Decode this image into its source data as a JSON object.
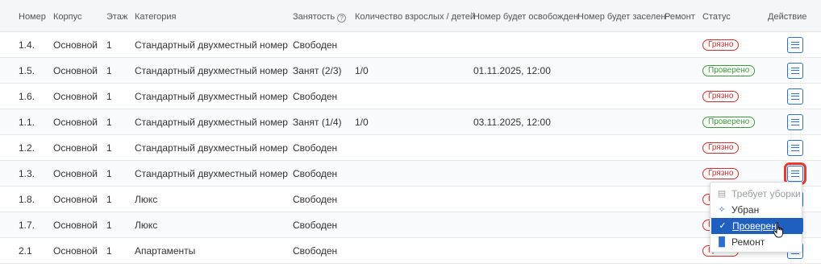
{
  "headers": {
    "num": "Номер",
    "building": "Корпус",
    "floor": "Этаж",
    "category": "Категория",
    "occupancy": "Занятость",
    "guests": "Количество взрослых / детей",
    "freed": "Номер будет освобожден",
    "settled": "Номер будет заселен",
    "repair": "Ремонт",
    "status": "Статус",
    "action": "Действие"
  },
  "rows": [
    {
      "num": "1.4.",
      "building": "Основной",
      "floor": "1",
      "category": "Стандартный двухместный номер",
      "occupancy": "Свободен",
      "guests": "",
      "freed": "",
      "status": "Грязно",
      "status_type": "dirty"
    },
    {
      "num": "1.5.",
      "building": "Основной",
      "floor": "1",
      "category": "Стандартный двухместный номер",
      "occupancy": "Занят (2/3)",
      "guests": "1/0",
      "freed": "01.11.2025, 12:00",
      "status": "Проверено",
      "status_type": "checked"
    },
    {
      "num": "1.6.",
      "building": "Основной",
      "floor": "1",
      "category": "Стандартный двухместный номер",
      "occupancy": "Свободен",
      "guests": "",
      "freed": "",
      "status": "Грязно",
      "status_type": "dirty"
    },
    {
      "num": "1.1.",
      "building": "Основной",
      "floor": "1",
      "category": "Стандартный двухместный номер",
      "occupancy": "Занят (1/4)",
      "guests": "1/0",
      "freed": "03.11.2025, 12:00",
      "status": "Проверено",
      "status_type": "checked"
    },
    {
      "num": "1.2.",
      "building": "Основной",
      "floor": "1",
      "category": "Стандартный двухместный номер",
      "occupancy": "Свободен",
      "guests": "",
      "freed": "",
      "status": "Грязно",
      "status_type": "dirty"
    },
    {
      "num": "1.3.",
      "building": "Основной",
      "floor": "1",
      "category": "Стандартный двухместный номер",
      "occupancy": "Свободен",
      "guests": "",
      "freed": "",
      "status": "Грязно",
      "status_type": "dirty"
    },
    {
      "num": "1.8.",
      "building": "Основной",
      "floor": "1",
      "category": "Люкс",
      "occupancy": "Свободен",
      "guests": "",
      "freed": "",
      "status": "Грязно",
      "status_type": "dirty"
    },
    {
      "num": "1.7.",
      "building": "Основной",
      "floor": "1",
      "category": "Люкс",
      "occupancy": "Свободен",
      "guests": "",
      "freed": "",
      "status": "Грязно",
      "status_type": "dirty"
    },
    {
      "num": "2.1",
      "building": "Основной",
      "floor": "1",
      "category": "Апартаменты",
      "occupancy": "Свободен",
      "guests": "",
      "freed": "",
      "status": "Грязно",
      "status_type": "dirty"
    }
  ],
  "menu": {
    "items": [
      {
        "label": "Требует уборки",
        "icon": "broom-icon",
        "disabled": true
      },
      {
        "label": "Убран",
        "icon": "sparkle-icon",
        "disabled": false
      },
      {
        "label": "Проверен",
        "icon": "check-icon",
        "selected": true
      },
      {
        "label": "Ремонт",
        "icon": "paint-roller-icon",
        "disabled": false
      }
    ]
  },
  "colors": {
    "dirty": "#d32f2f",
    "checked": "#3a9a3a",
    "accent": "#2d6fd0",
    "highlight": "#e53935"
  }
}
